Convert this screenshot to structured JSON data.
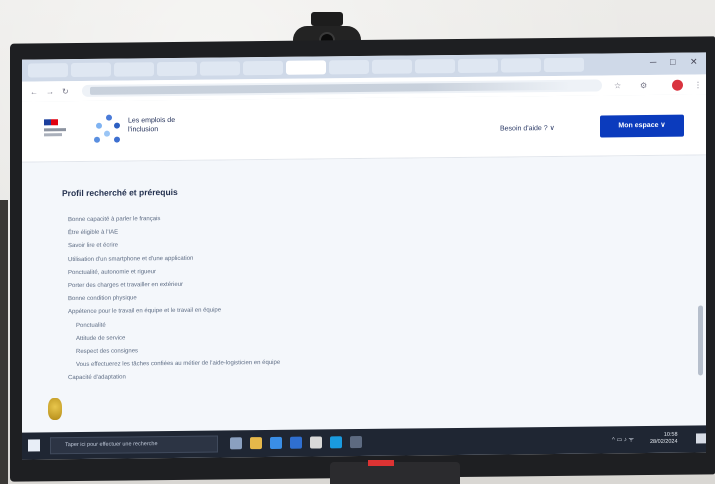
{
  "browser": {
    "tabs": [
      "",
      "",
      "",
      "",
      "",
      "",
      "",
      "",
      "",
      "",
      "",
      "",
      ""
    ]
  },
  "site": {
    "logo_name": "Les emplois de l'inclusion",
    "help_link": "Besoin d'aide ? ∨",
    "espace_button": "Mon espace ∨"
  },
  "main": {
    "heading": "Profil recherché et prérequis",
    "items": [
      {
        "text": "Bonne capacité à parler le français",
        "sub": false
      },
      {
        "text": "Être éligible à l'IAE",
        "sub": false
      },
      {
        "text": "Savoir lire et écrire",
        "sub": false
      },
      {
        "text": "Utilisation d'un smartphone et d'une application",
        "sub": false
      },
      {
        "text": "Ponctualité, autonomie et rigueur",
        "sub": false
      },
      {
        "text": "Porter des charges et travailler en extérieur",
        "sub": false
      },
      {
        "text": "Bonne condition physique",
        "sub": false
      },
      {
        "text": "Appétence pour le travail en équipe et le travail en équipe",
        "sub": false
      },
      {
        "text": "Ponctualité",
        "sub": true
      },
      {
        "text": "Attitude de service",
        "sub": true
      },
      {
        "text": "Respect des consignes",
        "sub": true
      },
      {
        "text": "Vous effectuerez les tâches confiées au métier de l'aide-logisticien en équipe",
        "sub": true
      },
      {
        "text": "Capacité d'adaptation",
        "sub": false
      }
    ]
  },
  "taskbar": {
    "search_placeholder": "Taper ici pour effectuer une recherche",
    "time": "10:58",
    "date": "28/02/2024"
  },
  "colors": {
    "primary_button": "#0b3bbd",
    "taskbar": "#1f2633",
    "record_dot": "#d9333f"
  }
}
